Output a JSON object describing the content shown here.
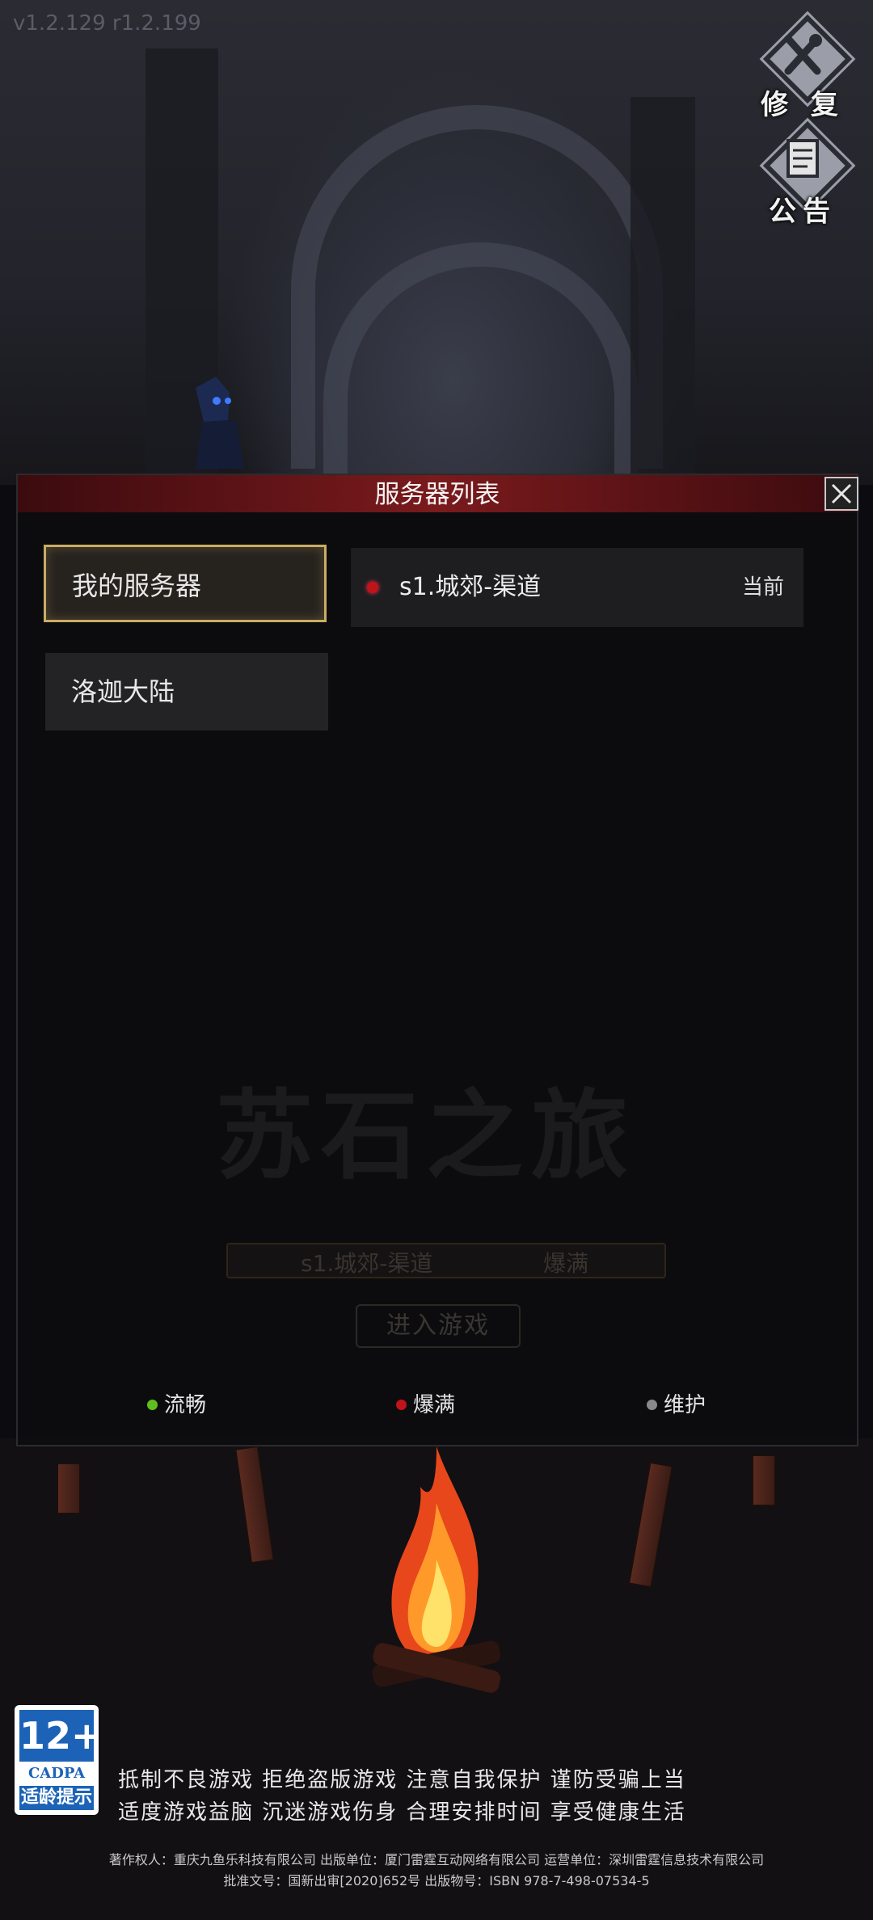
{
  "version": "v1.2.129 r1.2.199",
  "side_buttons": {
    "repair_label": "修 复",
    "notice_label": "公告"
  },
  "panel": {
    "title": "服务器列表",
    "categories": [
      {
        "label": "我的服务器",
        "active": true
      },
      {
        "label": "洛迦大陆",
        "active": false
      }
    ],
    "servers": [
      {
        "name": "s1.城郊-渠道",
        "status": "red",
        "current_label": "当前"
      }
    ],
    "watermark": "苏石之旅",
    "background_selected_server": "s1.城郊-渠道",
    "background_selected_status": "爆满",
    "background_enter_label": "进入游戏",
    "legend": [
      {
        "label": "流畅",
        "color": "#5fbf1e"
      },
      {
        "label": "爆满",
        "color": "#c0141a"
      },
      {
        "label": "维护",
        "color": "#8a8a8a"
      }
    ]
  },
  "age_rating": {
    "age": "12+",
    "org": "CADPA",
    "tip": "适龄提示"
  },
  "notices": [
    "抵制不良游戏 拒绝盗版游戏 注意自我保护 谨防受骗上当",
    "适度游戏益脑 沉迷游戏伤身 合理安排时间 享受健康生活"
  ],
  "copyright_lines": [
    "著作权人：重庆九鱼乐科技有限公司 出版单位：厦门雷霆互动网络有限公司 运营单位：深圳雷霆信息技术有限公司",
    "批准文号：国新出审[2020]652号 出版物号：ISBN 978-7-498-07534-5"
  ]
}
